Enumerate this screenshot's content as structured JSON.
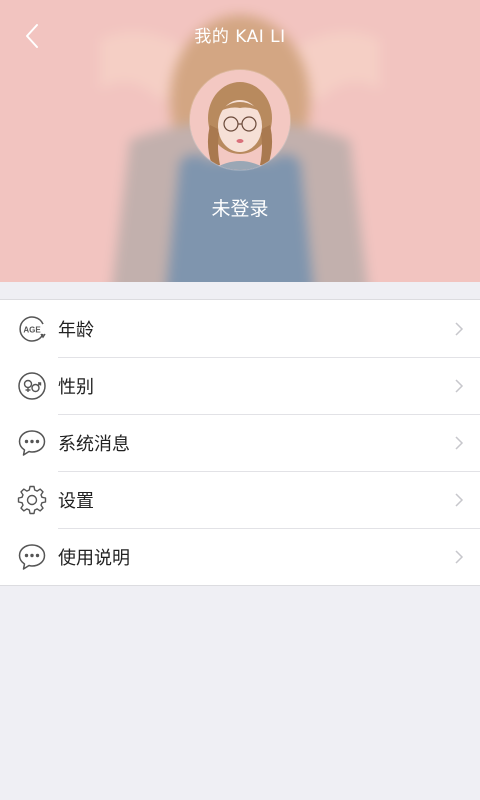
{
  "header": {
    "title": "我的 KAI LI",
    "login_status": "未登录"
  },
  "menu": {
    "items": [
      {
        "label": "年龄",
        "icon": "age-icon"
      },
      {
        "label": "性别",
        "icon": "gender-icon"
      },
      {
        "label": "系统消息",
        "icon": "chat-bubble-icon"
      },
      {
        "label": "设置",
        "icon": "gear-icon"
      },
      {
        "label": "使用说明",
        "icon": "chat-bubble-icon"
      }
    ],
    "chevron_icon": "chevron-right-icon"
  },
  "colors": {
    "header_bg": "#f1c4c0",
    "page_bg": "#efeff4",
    "text_primary": "#222222",
    "icon_color": "#555555",
    "chevron_color": "#c7c7cc"
  }
}
